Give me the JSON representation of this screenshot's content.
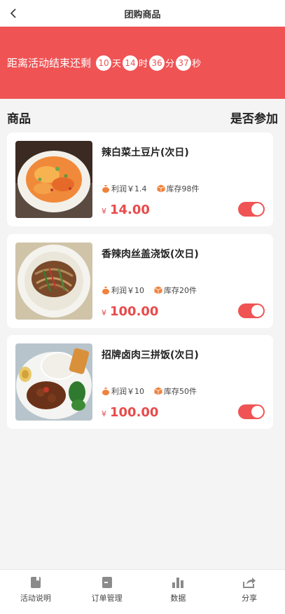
{
  "header": {
    "title": "团购商品"
  },
  "countdown": {
    "lead": "距离活动结束还剩",
    "days": "10",
    "days_unit": "天",
    "hours": "14",
    "hours_unit": "时",
    "minutes": "36",
    "minutes_unit": "分",
    "seconds": "37",
    "seconds_unit": "秒"
  },
  "list_header": {
    "left": "商品",
    "right": "是否参加"
  },
  "products": [
    {
      "name": "辣白菜土豆片(次日)",
      "profit": "利润￥1.4",
      "stock": "库存98件",
      "currency": "¥",
      "price": "14.00",
      "participating": true,
      "image": "spicy-potato-dish"
    },
    {
      "name": "香辣肉丝盖浇饭(次日)",
      "profit": "利润￥10",
      "stock": "库存20件",
      "currency": "¥",
      "price": "100.00",
      "participating": true,
      "image": "shredded-pork-rice"
    },
    {
      "name": "招牌卤肉三拼饭(次日)",
      "profit": "利润￥10",
      "stock": "库存50件",
      "currency": "¥",
      "price": "100.00",
      "participating": true,
      "image": "braised-pork-rice"
    }
  ],
  "tabs": [
    {
      "label": "活动说明",
      "icon": "document-icon"
    },
    {
      "label": "订单管理",
      "icon": "order-icon"
    },
    {
      "label": "数据",
      "icon": "bar-chart-icon"
    },
    {
      "label": "分享",
      "icon": "share-icon"
    }
  ],
  "colors": {
    "accent": "#f05354",
    "price": "#e84b4b",
    "icon_orange": "#f0823c"
  }
}
